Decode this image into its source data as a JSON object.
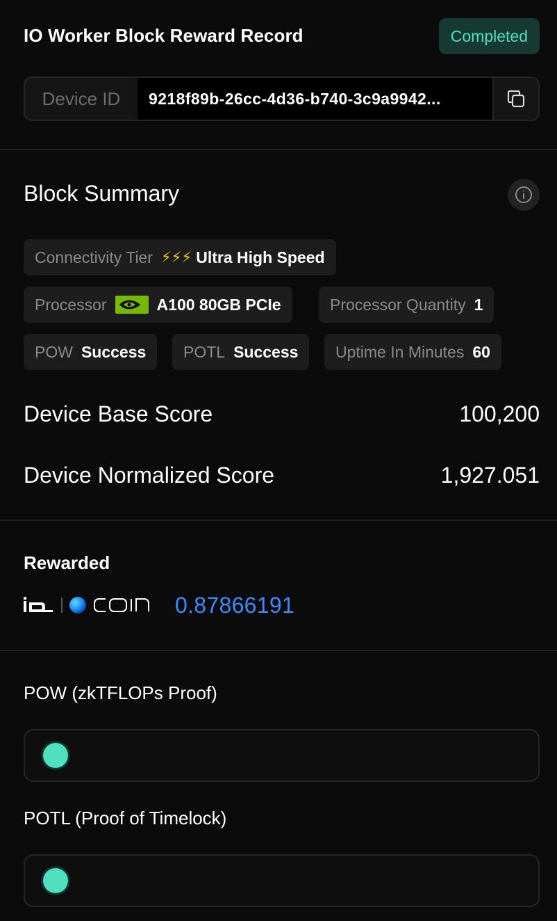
{
  "header": {
    "title": "IO Worker Block Reward Record",
    "status": "Completed"
  },
  "device": {
    "label": "Device ID",
    "id": "9218f89b-26cc-4d36-b740-3c9a9942..."
  },
  "summary": {
    "title": "Block Summary",
    "connectivity_label": "Connectivity Tier",
    "connectivity_icon": "⚡⚡⚡",
    "connectivity_value": "Ultra High Speed",
    "processor_label": "Processor",
    "processor_value": "A100 80GB PCIe",
    "processor_qty_label": "Processor Quantity",
    "processor_qty_value": "1",
    "pow_label": "POW",
    "pow_value": "Success",
    "potl_label": "POTL",
    "potl_value": "Success",
    "uptime_label": "Uptime In Minutes",
    "uptime_value": "60",
    "base_score_label": "Device Base Score",
    "base_score_value": "100,200",
    "normalized_score_label": "Device Normalized Score",
    "normalized_score_value": "1,927.051"
  },
  "reward": {
    "title": "Rewarded",
    "amount": "0.87866191"
  },
  "proofs": {
    "pow_title": "POW (zkTFLOPs Proof)",
    "potl_title": "POTL (Proof of Timelock)"
  },
  "colors": {
    "accent_green": "#4fe0bf",
    "reward_blue": "#3b8bff",
    "nvidia_green": "#76b900"
  }
}
